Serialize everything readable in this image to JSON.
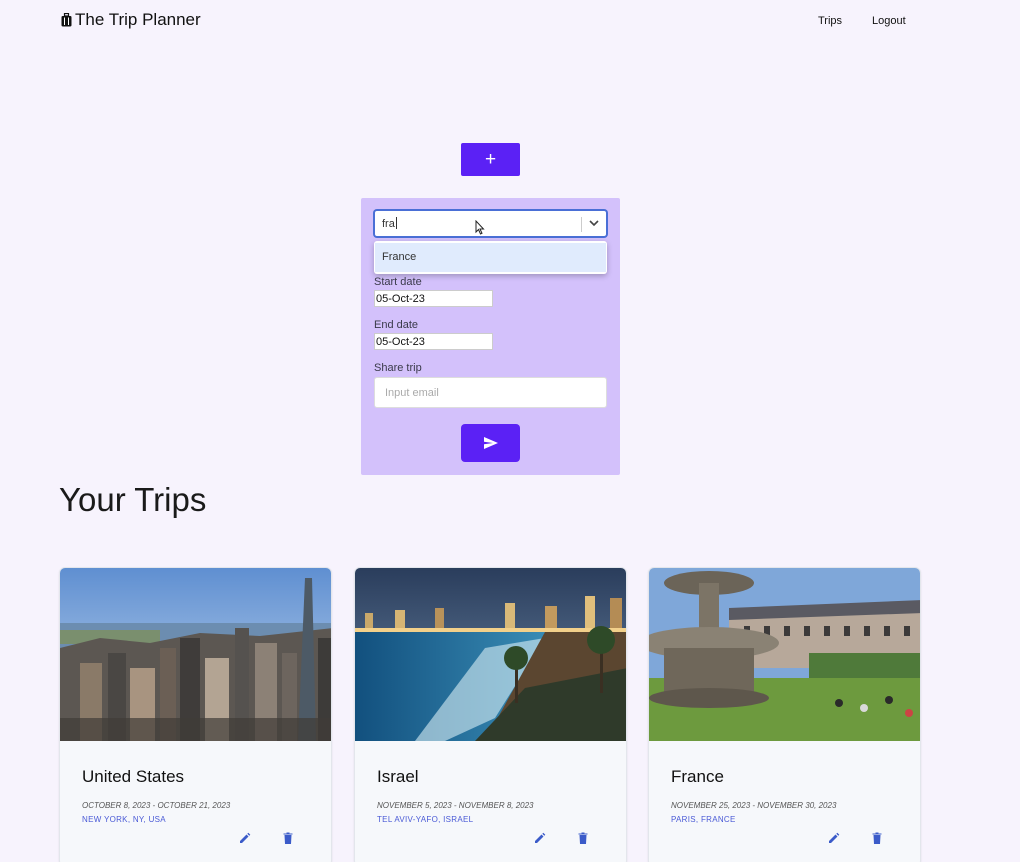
{
  "nav": {
    "brand": "The Trip Planner",
    "brand_icon": "suitcase-icon",
    "links": [
      "Trips",
      "Logout"
    ]
  },
  "add_button": {
    "label": "+"
  },
  "form": {
    "country_select": {
      "value": "fra",
      "icon": "chevron-down-icon"
    },
    "dropdown_options": [
      "France"
    ],
    "start_date": {
      "label": "Start date",
      "value": "05-Oct-23"
    },
    "end_date": {
      "label": "End date",
      "value": "05-Oct-23"
    },
    "share": {
      "label": "Share trip",
      "placeholder": "Input email"
    },
    "submit_icon": "send-icon"
  },
  "section": {
    "title": "Your Trips"
  },
  "trips": [
    {
      "title": "United States",
      "dates": "October 8, 2023 - October 21, 2023",
      "location": "New York, NY, USA"
    },
    {
      "title": "Israel",
      "dates": "November 5, 2023 - November 8, 2023",
      "location": "Tel Aviv-Yafo, Israel"
    },
    {
      "title": "France",
      "dates": "November 25, 2023 - November 30, 2023",
      "location": "Paris, France"
    }
  ],
  "colors": {
    "accent": "#5b21f5",
    "form_bg": "#d3c1fb",
    "page_bg": "#f7f3fd",
    "link": "#4a5ad6",
    "icon": "#3b5bc9"
  }
}
